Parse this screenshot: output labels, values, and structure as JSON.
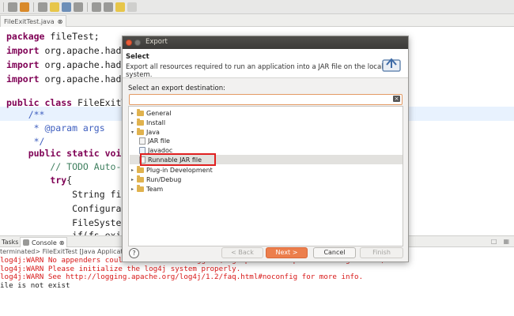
{
  "editor": {
    "tab_label": "FileExitTest.java",
    "tab_close": "⊗",
    "code_lines": [
      "package fileTest;",
      "import org.apache.hadoo",
      "import org.apache.hadoo",
      "import org.apache.hadoo",
      "",
      "public class FileExitTe",
      "    /**",
      "     * @param args",
      "     */",
      "    public static void",
      "        // TODO Auto-ge",
      "        try{",
      "            String file",
      "            Configurati",
      "            FileSystem",
      "            if(fs.exist"
    ]
  },
  "bottom": {
    "tasks_tab": "Tasks",
    "console_tab": "Console",
    "console_close": "⊗",
    "console_header": "terminated> FileExitTest [Java Application] /",
    "console_lines": [
      "log4j:WARN No appenders could be found for logger (org.apache.hadoop.conf.Configuration).",
      "log4j:WARN Please initialize the log4j system properly.",
      "log4j:WARN See http://logging.apache.org/log4j/1.2/faq.html#noconfig for more info.",
      "ile is not exist"
    ]
  },
  "dialog": {
    "title": "Export",
    "section_title": "Select",
    "section_desc": "Export all resources required to run an application into a JAR file on the local file system.",
    "dest_label": "Select an export destination:",
    "filter_value": "",
    "tree": [
      {
        "label": "General",
        "expander": "▸"
      },
      {
        "label": "Install",
        "expander": "▸"
      },
      {
        "label": "Java",
        "expander": "▾"
      },
      {
        "label": "JAR file"
      },
      {
        "label": "Javadoc"
      },
      {
        "label": "Runnable JAR file"
      },
      {
        "label": "Plug-in Development",
        "expander": "▸"
      },
      {
        "label": "Run/Debug",
        "expander": "▸"
      },
      {
        "label": "Team",
        "expander": "▸"
      }
    ],
    "help": "?",
    "buttons": {
      "back": "< Back",
      "next": "Next >",
      "cancel": "Cancel",
      "finish": "Finish"
    }
  },
  "colors": {
    "accent": "#ec7e4c",
    "highlight_box": "#e02020",
    "warn_text": "#d81818"
  }
}
